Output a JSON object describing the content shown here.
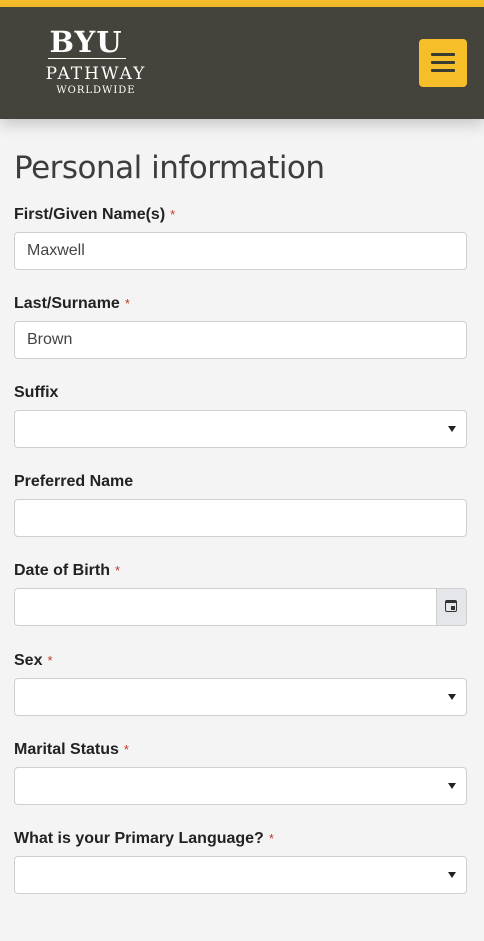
{
  "header": {
    "logo": {
      "line1": "BYU",
      "line2": "PATHWAY",
      "line3": "WORLDWIDE"
    },
    "menu_icon": "hamburger-menu-icon",
    "colors": {
      "accent": "#f6be29",
      "background": "#44443c"
    }
  },
  "page": {
    "title": "Personal information"
  },
  "form": {
    "first_name": {
      "label": "First/Given Name(s)",
      "required": "*",
      "value": "Maxwell"
    },
    "last_name": {
      "label": "Last/Surname",
      "required": "*",
      "value": "Brown"
    },
    "suffix": {
      "label": "Suffix",
      "value": ""
    },
    "preferred_name": {
      "label": "Preferred Name",
      "value": ""
    },
    "date_of_birth": {
      "label": "Date of Birth",
      "required": "*",
      "value": "",
      "icon": "calendar-icon"
    },
    "sex": {
      "label": "Sex",
      "required": "*",
      "value": ""
    },
    "marital_status": {
      "label": "Marital Status",
      "required": "*",
      "value": ""
    },
    "primary_language": {
      "label": "What is your Primary Language?",
      "required": "*",
      "value": ""
    }
  }
}
